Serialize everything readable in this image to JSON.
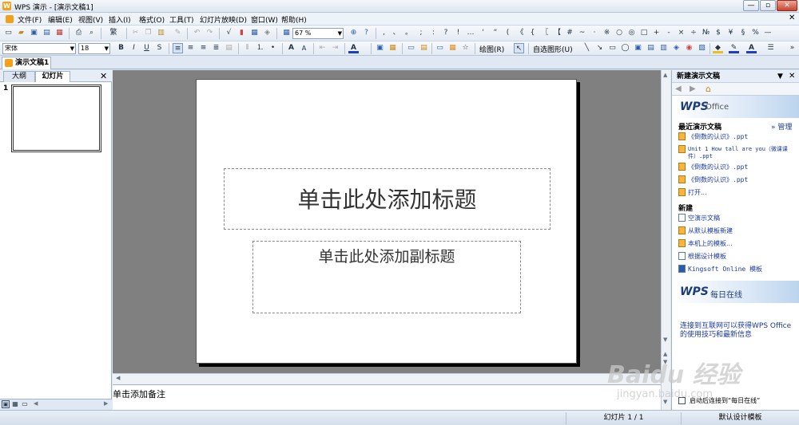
{
  "window": {
    "title": "WPS 演示 - [演示文稿1]",
    "controls": [
      "—",
      "▫",
      "✕"
    ]
  },
  "menu": [
    "文件(F)",
    "编辑(E)",
    "视图(V)",
    "插入(I)",
    "格式(O)",
    "工具(T)",
    "幻灯片放映(D)",
    "窗口(W)",
    "帮助(H)"
  ],
  "toolbar": {
    "zoom": "67 %",
    "font_name": "宋体",
    "font_size": "18",
    "chinese_convert": "繁",
    "draw_label": "绘图(R)",
    "autoshape_label": "自选图形(U)",
    "symbols": [
      ",",
      "、",
      "。",
      ";",
      ":",
      "?",
      "!",
      "…",
      "'",
      "“",
      "(",
      "《",
      "{",
      "〖",
      "【",
      "#",
      "~",
      "·",
      "※",
      "○",
      "◎",
      "□",
      "+",
      "-",
      "×",
      "÷",
      "№",
      "$",
      "¥",
      "§",
      "%",
      "—"
    ]
  },
  "doc_tab": {
    "label": "演示文稿1"
  },
  "left_panel": {
    "tabs": [
      "大纲",
      "幻灯片"
    ],
    "slide_number": "1"
  },
  "slide": {
    "title_placeholder": "单击此处添加标题",
    "subtitle_placeholder": "单击此处添加副标题"
  },
  "notes": {
    "placeholder": "单击添加备注"
  },
  "task_pane": {
    "header": "新建演示文稿",
    "brand": "WPS",
    "brand_sub": "Office",
    "recent_header": "最近演示文稿",
    "manage_link": "» 管理",
    "recent": [
      "《倒数的认识》.ppt",
      "Unit 1 How tall are you（微课课件）.ppt",
      "《倒数的认识》.ppt",
      "《倒数的认识》.ppt",
      "打开..."
    ],
    "new_header": "新建",
    "new_items": [
      "空演示文稿",
      "从默认模板新建",
      "本机上的模板...",
      "根据设计模板",
      "Kingsoft Online 模板"
    ],
    "online_brand": "WPS",
    "online_sub": "每日在线",
    "online_text": "连接到互联网可以获得WPS Office的使用技巧和最新信息",
    "auto_connect": "启动后连接到“每日在线”"
  },
  "status": {
    "slide_info": "幻灯片 1 / 1",
    "template": "默认设计模板"
  },
  "watermark": {
    "line1": "Baidu 经验",
    "line2": "jingyan.baidu.com"
  }
}
